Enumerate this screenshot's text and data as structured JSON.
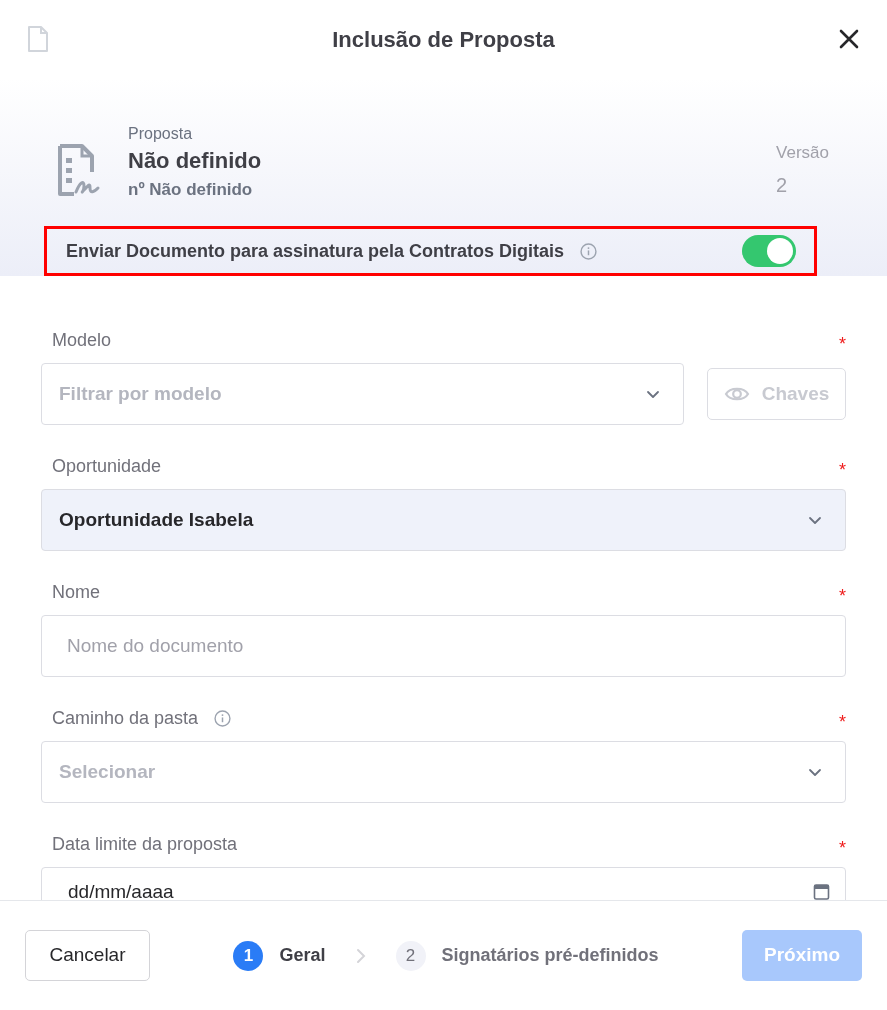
{
  "window": {
    "title": "Inclusão de Proposta"
  },
  "summary": {
    "caption": "Proposta",
    "name": "Não definido",
    "number": "nº Não definido",
    "version_label": "Versão",
    "version": "2"
  },
  "signature_toggle": {
    "label": "Enviar Documento para assinatura pela Contratos Digitais",
    "on": true,
    "highlighted": true
  },
  "fields": [
    {
      "kind": "select",
      "label": "Modelo",
      "required_mark": "*",
      "placeholder": "Filtrar por modelo",
      "side_button": "Chaves"
    },
    {
      "kind": "select",
      "label": "Oportunidade",
      "required_mark": "*",
      "value": "Oportunidade Isabela",
      "filled": true
    },
    {
      "kind": "text",
      "label": "Nome",
      "required_mark": "*",
      "placeholder": "Nome do documento"
    },
    {
      "kind": "select",
      "label": "Caminho da pasta",
      "required_mark": "*",
      "info": true,
      "placeholder": "Selecionar"
    },
    {
      "kind": "date",
      "label": "Data limite da proposta",
      "required_mark": "*",
      "value": "dd/mm/aaaa"
    }
  ],
  "footer": {
    "cancel": "Cancelar",
    "steps": [
      {
        "number": "1",
        "label": "Geral",
        "selected": true
      },
      {
        "number": "2",
        "label": "Signatários pré-definidos",
        "selected": false
      }
    ],
    "next": "Próximo",
    "next_disabled": true
  }
}
